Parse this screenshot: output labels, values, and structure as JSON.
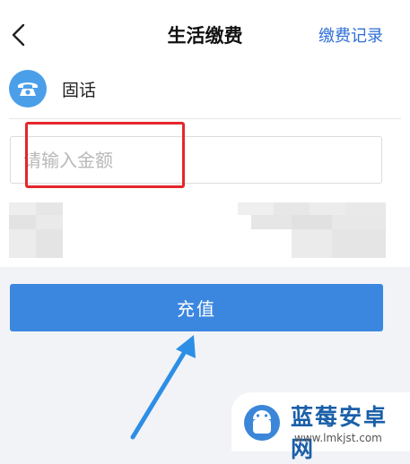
{
  "header": {
    "title": "生活缴费",
    "records_link": "缴费记录"
  },
  "service": {
    "name": "固话",
    "icon": "telephone-icon"
  },
  "amount_input": {
    "placeholder": "请输入金额",
    "value": ""
  },
  "recharge_button": {
    "label": "充值"
  },
  "watermark": {
    "title": "蓝莓安卓网",
    "url": "www.lmkjst.com"
  },
  "colors": {
    "accent": "#3b87e0",
    "link": "#2f6fd6",
    "annotation": "#e4262c",
    "arrow": "#2d8ee6"
  }
}
